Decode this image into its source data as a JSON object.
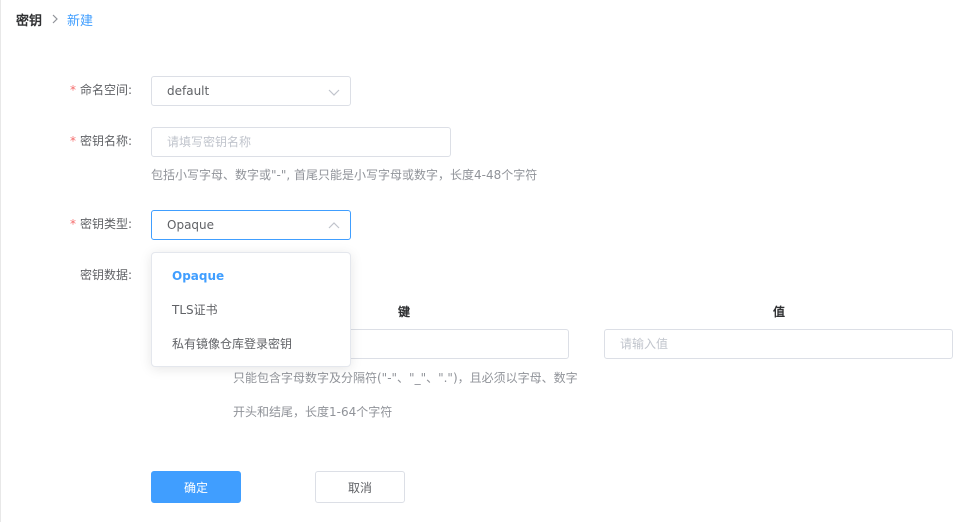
{
  "breadcrumb": {
    "root": "密钥",
    "current": "新建"
  },
  "form": {
    "namespace": {
      "label": "命名空间:",
      "value": "default"
    },
    "name": {
      "label": "密钥名称:",
      "placeholder": "请填写密钥名称",
      "hint": "包括小写字母、数字或\"-\", 首尾只能是小写字母或数字，长度4-48个字符"
    },
    "type": {
      "label": "密钥类型:",
      "value": "Opaque"
    },
    "data": {
      "label": "密钥数据:",
      "key_header": "键",
      "value_header": "值",
      "value_placeholder": "请输入值",
      "key_hint_line1": "只能包含字母数字及分隔符(\"-\"、\"_\"、\".\")，且必须以字母、数字",
      "key_hint_line2": "开头和结尾，长度1-64个字符"
    }
  },
  "dropdown": {
    "options": [
      "Opaque",
      "TLS证书",
      "私有镜像仓库登录密钥"
    ],
    "selected_index": 0
  },
  "buttons": {
    "confirm": "确定",
    "cancel": "取消"
  },
  "colors": {
    "primary": "#409eff",
    "required": "#f56c6c",
    "border": "#dcdfe6"
  },
  "icons": {
    "breadcrumb_separator": "chevron-right-icon",
    "select_arrow_closed": "chevron-down-icon",
    "select_arrow_open": "chevron-up-icon"
  }
}
